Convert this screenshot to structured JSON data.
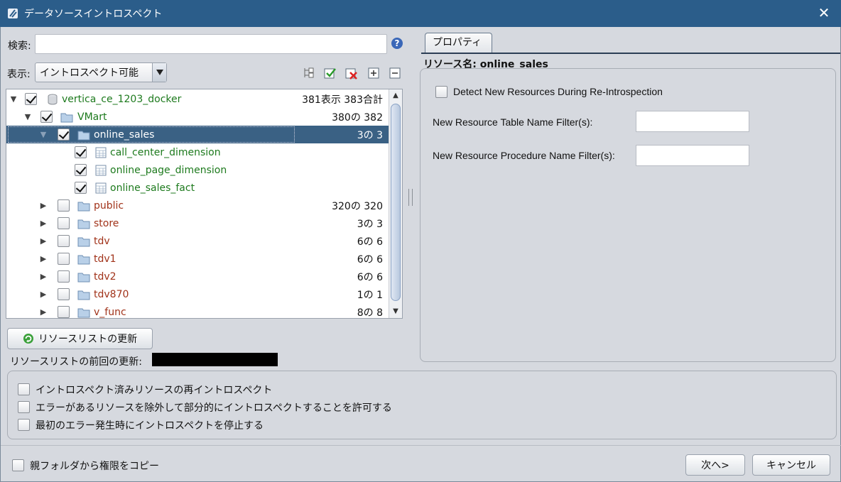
{
  "window": {
    "title": "データソースイントロスペクト",
    "close_glyph": "✕"
  },
  "search": {
    "label": "検索:",
    "value": "",
    "help_glyph": "?"
  },
  "display": {
    "label": "表示:",
    "selected": "イントロスペクト可能"
  },
  "toolbar": {
    "icons": [
      "tree-expand-icon",
      "check-all-icon",
      "uncheck-all-icon",
      "expand-all-icon",
      "collapse-all-icon"
    ]
  },
  "tree": {
    "rows": [
      {
        "name": "vertica_ce_1203_docker",
        "count": "381表示 383合計",
        "level": 0,
        "checked": true,
        "expanded": true,
        "type": "datasource",
        "color": "green"
      },
      {
        "name": "VMart",
        "count": "380の 382",
        "level": 1,
        "checked": true,
        "expanded": true,
        "type": "folder",
        "color": "green"
      },
      {
        "name": "online_sales",
        "count": "3の 3",
        "level": 2,
        "checked": true,
        "expanded": true,
        "type": "folder",
        "color": "green",
        "selected": true
      },
      {
        "name": "call_center_dimension",
        "count": "",
        "level": 3,
        "checked": true,
        "type": "table",
        "color": "green"
      },
      {
        "name": "online_page_dimension",
        "count": "",
        "level": 3,
        "checked": true,
        "type": "table",
        "color": "green"
      },
      {
        "name": "online_sales_fact",
        "count": "",
        "level": 3,
        "checked": true,
        "type": "table",
        "color": "green"
      },
      {
        "name": "public",
        "count": "320の 320",
        "level": 2,
        "checked": false,
        "expanded": false,
        "type": "folder",
        "color": "red"
      },
      {
        "name": "store",
        "count": "3の 3",
        "level": 2,
        "checked": false,
        "expanded": false,
        "type": "folder",
        "color": "red"
      },
      {
        "name": "tdv",
        "count": "6の 6",
        "level": 2,
        "checked": false,
        "expanded": false,
        "type": "folder",
        "color": "red"
      },
      {
        "name": "tdv1",
        "count": "6の 6",
        "level": 2,
        "checked": false,
        "expanded": false,
        "type": "folder",
        "color": "red"
      },
      {
        "name": "tdv2",
        "count": "6の 6",
        "level": 2,
        "checked": false,
        "expanded": false,
        "type": "folder",
        "color": "red"
      },
      {
        "name": "tdv870",
        "count": "1の 1",
        "level": 2,
        "checked": false,
        "expanded": false,
        "type": "folder",
        "color": "red"
      },
      {
        "name": "v_func",
        "count": "8の 8",
        "level": 2,
        "checked": false,
        "expanded": false,
        "type": "folder",
        "color": "red"
      }
    ]
  },
  "refresh": {
    "label": "リソースリストの更新",
    "last_update_label": "リソースリストの前回の更新:"
  },
  "properties": {
    "tab_label": "プロパティ",
    "resource_title": "リソース名: online_sales",
    "detect_new": {
      "label": "Detect New Resources During Re-Introspection",
      "checked": false
    },
    "table_filter": {
      "label": "New Resource Table Name Filter(s):",
      "value": ""
    },
    "procedure_filter": {
      "label": "New Resource Procedure Name Filter(s):",
      "value": ""
    }
  },
  "options": [
    {
      "label": "イントロスペクト済みリソースの再イントロスペクト",
      "checked": false
    },
    {
      "label": "エラーがあるリソースを除外して部分的にイントロスペクトすることを許可する",
      "checked": false
    },
    {
      "label": "最初のエラー発生時にイントロスペクトを停止する",
      "checked": false
    }
  ],
  "footer": {
    "copy_permissions": {
      "label": "親フォルダから権限をコピー",
      "checked": false
    },
    "next_label": "次へ>",
    "cancel_label": "キャンセル"
  },
  "colors": {
    "titlebar": "#2b5d8a",
    "selection": "#3a6184",
    "ok_text": "#1d7a1d",
    "new_text": "#a1331a"
  }
}
